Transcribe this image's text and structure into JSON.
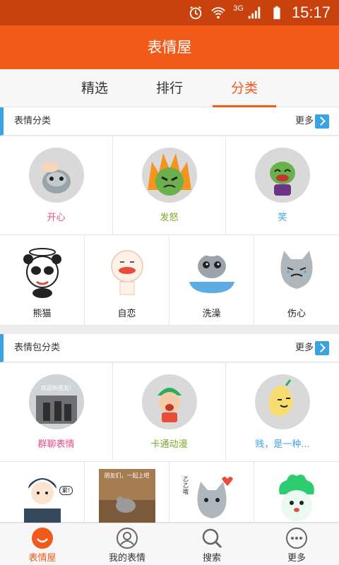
{
  "status_bar": {
    "network": "3G",
    "time": "15:17"
  },
  "app": {
    "title": "表情屋"
  },
  "tabs": [
    {
      "label": "精选"
    },
    {
      "label": "排行"
    },
    {
      "label": "分类"
    }
  ],
  "colors": {
    "brand": "#f25a1a",
    "accent_blue": "#3aa3e3",
    "pink": "#e64a8a",
    "green": "#7aa82a",
    "blue": "#3aa3e3"
  },
  "section1": {
    "title": "表情分类",
    "more": "更多",
    "top_items": [
      {
        "label": "开心",
        "icon": "cat-hand-icon"
      },
      {
        "label": "发怒",
        "icon": "angry-face-icon"
      },
      {
        "label": "笑",
        "icon": "laugh-face-icon"
      }
    ],
    "bottom_items": [
      {
        "label": "熊猫",
        "icon": "panda-icon"
      },
      {
        "label": "自恋",
        "icon": "smile-character-icon"
      },
      {
        "label": "洗澡",
        "icon": "cat-bath-icon"
      },
      {
        "label": "伤心",
        "icon": "sad-cat-icon"
      }
    ]
  },
  "section2": {
    "title": "表情包分类",
    "more": "更多",
    "top_items": [
      {
        "label": "群聊表情",
        "icon": "group-chat-photo-icon",
        "caption": "欢迎新朋友!"
      },
      {
        "label": "卡通动漫",
        "icon": "cartoon-boy-icon"
      },
      {
        "label": "贱，是一种...",
        "icon": "pear-character-icon"
      }
    ],
    "bottom_items": [
      {
        "label": "",
        "icon": "boy-laptop-icon",
        "bubble": "累!"
      },
      {
        "label": "",
        "icon": "rat-photo-icon",
        "caption": "朋友们，一起上吧"
      },
      {
        "label": "",
        "icon": "cat-sticker-icon",
        "caption": "乙乙哦"
      },
      {
        "label": "",
        "icon": "cabbage-character-icon"
      }
    ]
  },
  "bottom_nav": [
    {
      "label": "表情屋",
      "icon": "smile-circle-icon"
    },
    {
      "label": "我的表情",
      "icon": "user-icon"
    },
    {
      "label": "搜索",
      "icon": "search-icon"
    },
    {
      "label": "更多",
      "icon": "more-dots-icon"
    }
  ]
}
